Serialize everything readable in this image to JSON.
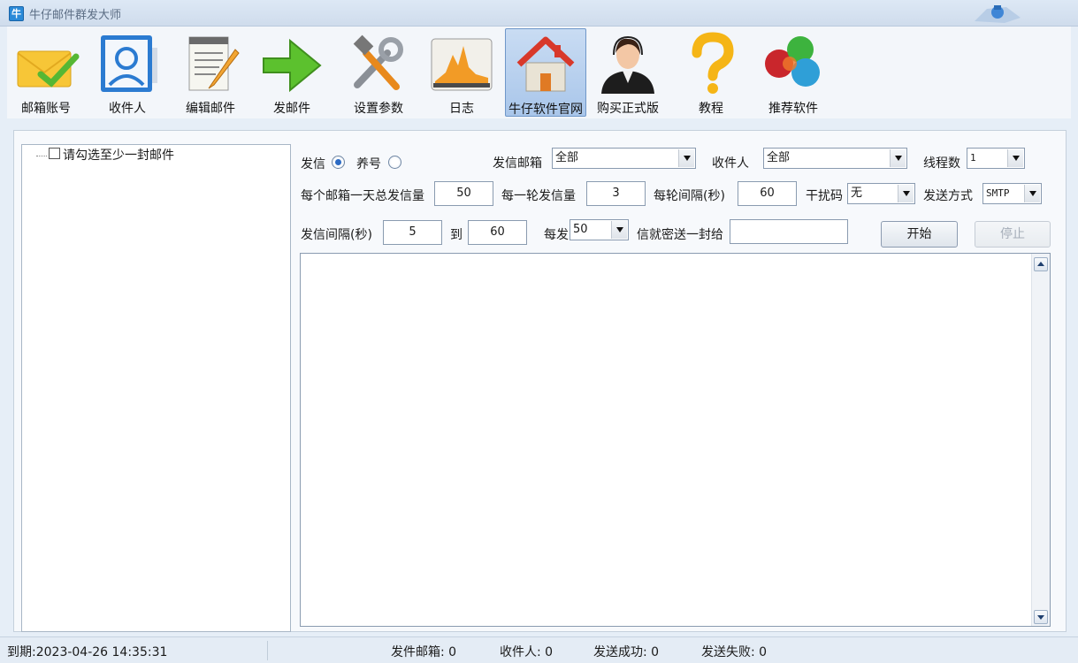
{
  "window": {
    "title": "牛仔邮件群发大师",
    "app_icon_char": "牛"
  },
  "toolbar": {
    "items": [
      {
        "label": "邮箱账号",
        "icon": "envelope-check-icon"
      },
      {
        "label": "收件人",
        "icon": "contact-card-icon"
      },
      {
        "label": "编辑邮件",
        "icon": "notepad-pencil-icon"
      },
      {
        "label": "发邮件",
        "icon": "green-arrow-icon"
      },
      {
        "label": "设置参数",
        "icon": "tools-icon"
      },
      {
        "label": "日志",
        "icon": "chart-log-icon"
      },
      {
        "label": "牛仔软件官网",
        "icon": "home-icon",
        "active": true
      },
      {
        "label": "购买正式版",
        "icon": "support-agent-icon"
      },
      {
        "label": "教程",
        "icon": "question-icon"
      },
      {
        "label": "推荐软件",
        "icon": "color-balls-icon"
      }
    ]
  },
  "tree": {
    "root_label": "请勾选至少一封邮件"
  },
  "settings": {
    "send_label": "发信",
    "nurture_label": "养号",
    "send_selected": true,
    "sender_mailbox_label": "发信邮箱",
    "sender_mailbox_value": "全部",
    "recipient_label": "收件人",
    "recipient_value": "全部",
    "threads_label": "线程数",
    "threads_value": "1",
    "daily_total_label": "每个邮箱一天总发信量",
    "daily_total_value": "50",
    "per_round_label": "每一轮发信量",
    "per_round_value": "3",
    "round_interval_label": "每轮间隔(秒)",
    "round_interval_value": "60",
    "interference_label": "干扰码",
    "interference_value": "无",
    "send_method_label": "发送方式",
    "send_method_value": "SMTP",
    "interval_label": "发信间隔(秒)",
    "interval_from": "5",
    "to_label": "到",
    "interval_to": "60",
    "every_label": "每发",
    "every_value": "50",
    "bcc_label": "信就密送一封给",
    "bcc_value": ""
  },
  "buttons": {
    "start": "开始",
    "stop": "停止"
  },
  "status": {
    "expiry": "到期:2023-04-26 14:35:31",
    "sender_count": "发件邮箱: 0",
    "recipient_count": "收件人: 0",
    "success_count": "发送成功: 0",
    "fail_count": "发送失败: 0"
  },
  "colors": {
    "accent": "#2c6bc4",
    "active_tool": "#a9c6ea"
  }
}
